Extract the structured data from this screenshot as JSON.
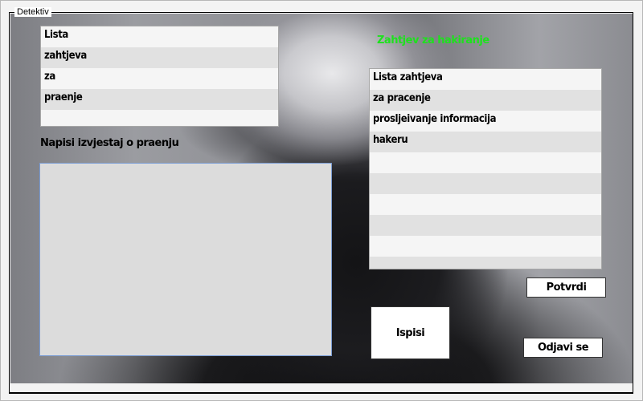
{
  "window": {
    "title": "Detektiv"
  },
  "left_list": {
    "rows": [
      "Lista",
      "zahtjeva",
      "za",
      "praenje",
      ""
    ]
  },
  "report_label": "Napisi izvjestaj o praenju",
  "report_text": "",
  "hack_request_label": "Zahtjev za hakiranje",
  "hack_request_color": "#1ee11e",
  "right_list": {
    "rows": [
      "Lista zahtjeva",
      "za pracenje",
      "prosljeivanje informacija",
      "hakeru",
      "",
      "",
      "",
      "",
      "",
      ""
    ]
  },
  "buttons": {
    "confirm": "Potvrdi",
    "print": "Ispisi",
    "logout": "Odjavi se"
  }
}
